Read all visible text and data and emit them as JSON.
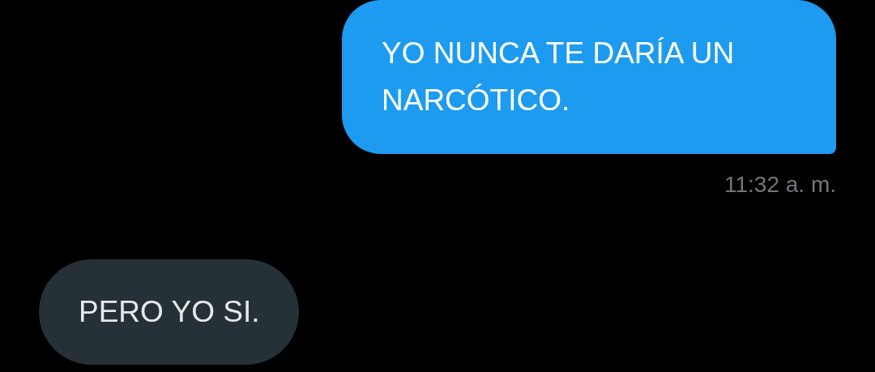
{
  "messages": [
    {
      "kind": "sent",
      "text": "YO NUNCA TE DARÍA UN NARCÓTICO.",
      "time": "11:32 a. m."
    },
    {
      "kind": "received",
      "text": "PERO YO SI."
    }
  ]
}
